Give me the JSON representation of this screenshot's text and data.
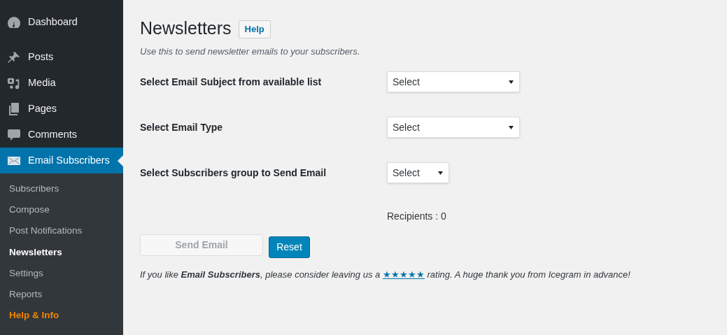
{
  "sidebar": {
    "items": [
      {
        "label": "Dashboard",
        "selected": false
      },
      {
        "label": "Posts",
        "selected": false
      },
      {
        "label": "Media",
        "selected": false
      },
      {
        "label": "Pages",
        "selected": false
      },
      {
        "label": "Comments",
        "selected": false
      },
      {
        "label": "Email Subscribers",
        "selected": true
      }
    ],
    "submenu": [
      {
        "label": "Subscribers",
        "selected": false,
        "highlighted": false
      },
      {
        "label": "Compose",
        "selected": false,
        "highlighted": false
      },
      {
        "label": "Post Notifications",
        "selected": false,
        "highlighted": false
      },
      {
        "label": "Newsletters",
        "selected": true,
        "highlighted": false
      },
      {
        "label": "Settings",
        "selected": false,
        "highlighted": false
      },
      {
        "label": "Reports",
        "selected": false,
        "highlighted": false
      },
      {
        "label": "Help & Info",
        "selected": false,
        "highlighted": true
      }
    ]
  },
  "page": {
    "title": "Newsletters",
    "help_button": "Help",
    "description": "Use this to send newsletter emails to your subscribers.",
    "fields": [
      {
        "label": "Select Email Subject from available list",
        "value": "Select"
      },
      {
        "label": "Select Email Type",
        "value": "Select"
      },
      {
        "label": "Select Subscribers group to Send Email",
        "value": "Select"
      }
    ],
    "recipients": "Recipients : 0",
    "buttons": [
      {
        "label": "Send Email",
        "kind": "secondary",
        "disabled": true
      },
      {
        "label": "Reset",
        "kind": "primary",
        "disabled": false
      }
    ],
    "footer": {
      "before": "If you like **Email Subscribers**, please consider leaving us a ",
      "link": "★★★★★",
      "after": " rating. A huge thank you from Icegram in advance!"
    }
  }
}
